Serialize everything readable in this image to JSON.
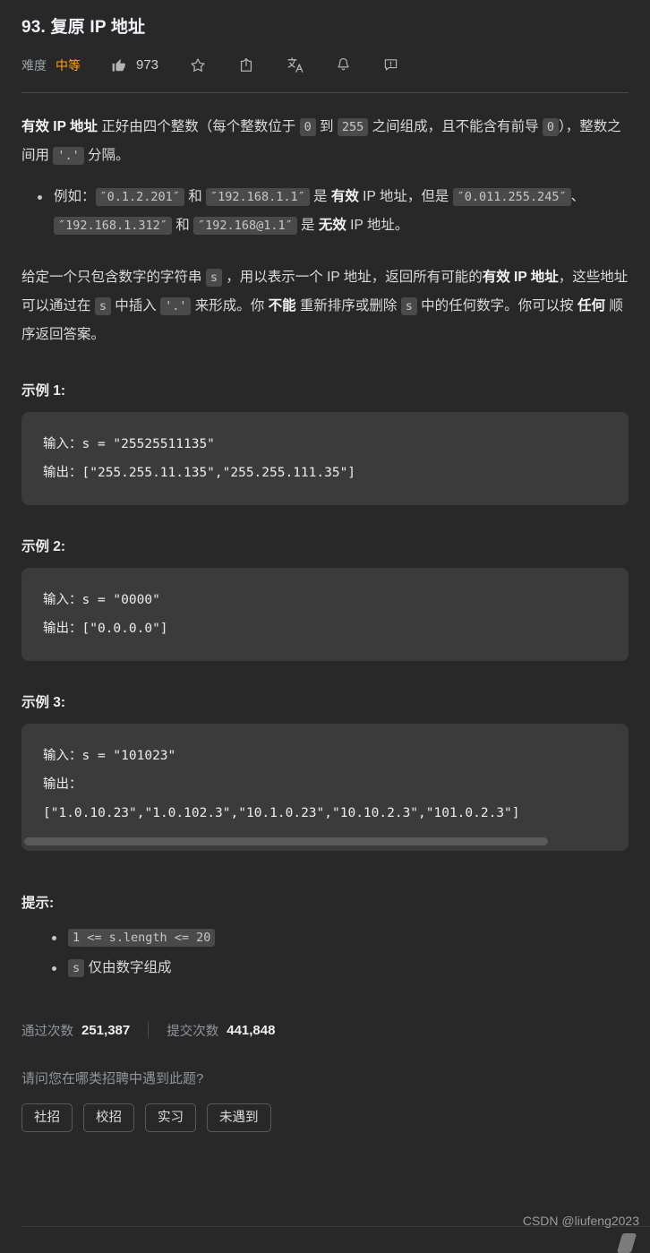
{
  "header": {
    "title": "93. 复原 IP 地址",
    "difficulty_label": "难度",
    "difficulty_value": "中等",
    "difficulty_color": "#ffa116",
    "like_count": "973",
    "icons": {
      "like": "thumbs-up-icon",
      "star": "star-icon",
      "share": "share-icon",
      "translate": "translate-icon",
      "bell": "bell-icon",
      "feedback": "feedback-icon"
    }
  },
  "description": {
    "p1": {
      "bold_lead": "有效 IP 地址",
      "t1": " 正好由四个整数（每个整数位于 ",
      "c1": "0",
      "t2": " 到 ",
      "c2": "255",
      "t3": " 之间组成，且不能含有前导 ",
      "c3": "0",
      "t4": "），整数之间用 ",
      "c4": "'.'",
      "t5": " 分隔。"
    },
    "bullet1": {
      "t1": "例如：",
      "c1": "″0.1.2.201″",
      "t2": " 和 ",
      "c2": "″192.168.1.1″",
      "t3": " 是 ",
      "b1": "有效",
      "t4": " IP 地址，但是 ",
      "c3": "″0.011.255.245″",
      "t5": "、",
      "c4": "″192.168.1.312″",
      "t6": " 和 ",
      "c5": "″192.168@1.1″",
      "t7": " 是 ",
      "b2": "无效",
      "t8": " IP 地址。"
    },
    "p2": {
      "t1": "给定一个只包含数字的字符串 ",
      "c1": "s",
      "t2": " ，用以表示一个 IP 地址，返回所有可能的",
      "b1": "有效 IP 地址",
      "t3": "，这些地址可以通过在 ",
      "c2": "s",
      "t4": " 中插入 ",
      "c3": "'.'",
      "t5": " 来形成。你 ",
      "b2": "不能",
      "t6": " 重新排序或删除 ",
      "c4": "s",
      "t7": " 中的任何数字。你可以按 ",
      "b3": "任何",
      "t8": " 顺序返回答案。"
    }
  },
  "examples": [
    {
      "title": "示例 1:",
      "code": "输入：s = \"25525511135\"\n输出：[\"255.255.11.135\",\"255.255.111.35\"]",
      "has_scrollbar": false
    },
    {
      "title": "示例 2:",
      "code": "输入：s = \"0000\"\n输出：[\"0.0.0.0\"]",
      "has_scrollbar": false
    },
    {
      "title": "示例 3:",
      "code": "输入：s = \"101023\"\n输出：\n[\"1.0.10.23\",\"1.0.102.3\",\"10.1.0.23\",\"10.10.2.3\",\"101.0.2.3\"]",
      "has_scrollbar": true
    }
  ],
  "hints": {
    "title": "提示:",
    "items": [
      {
        "code": "1 <= s.length <= 20",
        "text": ""
      },
      {
        "code": "s",
        "text": " 仅由数字组成"
      }
    ]
  },
  "stats": {
    "accepted_label": "通过次数",
    "accepted_value": "251,387",
    "submissions_label": "提交次数",
    "submissions_value": "441,848"
  },
  "poll": {
    "question": "请问您在哪类招聘中遇到此题?",
    "options": [
      "社招",
      "校招",
      "实习",
      "未遇到"
    ]
  },
  "watermark": "CSDN @liufeng2023"
}
